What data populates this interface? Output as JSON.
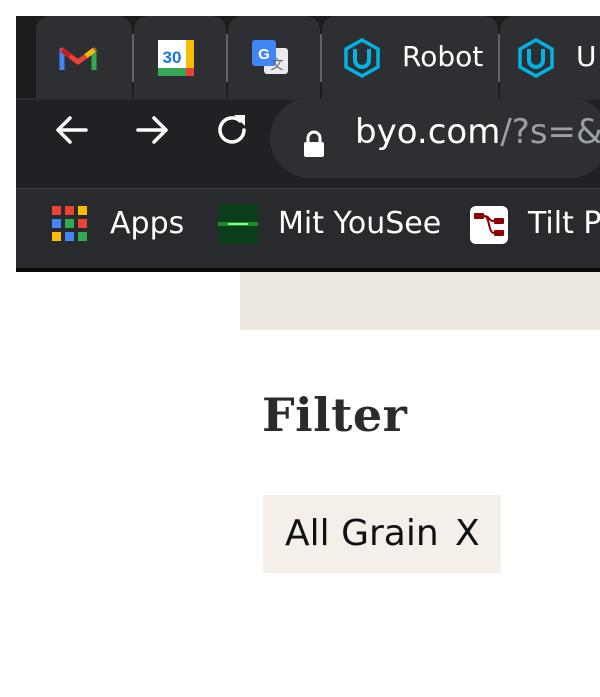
{
  "browser": {
    "tabs": [
      {
        "icon": "gmail-icon",
        "title": ""
      },
      {
        "icon": "google-calendar-icon",
        "title": "",
        "calendar_day": "30"
      },
      {
        "icon": "google-translate-icon",
        "title": "",
        "glyph_g": "G",
        "glyph_wen": "文"
      },
      {
        "icon": "udacity-icon",
        "title": "Robot"
      },
      {
        "icon": "udacity-icon",
        "title": "U"
      }
    ],
    "address_bar": {
      "host": "byo.com",
      "path": "/?s=&"
    },
    "bookmarks": [
      {
        "icon": "apps-grid-icon",
        "label": "Apps"
      },
      {
        "icon": "mit-yousee-icon",
        "label": "Mit YouSee"
      },
      {
        "icon": "node-red-icon",
        "label": "Tilt Pi"
      }
    ]
  },
  "page": {
    "filter_heading": "Filter",
    "active_filters": [
      {
        "label": "All Grain",
        "remove_label": "X"
      }
    ]
  },
  "colors": {
    "chrome_bg": "#202124",
    "band_bg": "#ede8e0",
    "chip_bg": "#f4f0e9",
    "udacity_blue": "#02b3e4"
  }
}
